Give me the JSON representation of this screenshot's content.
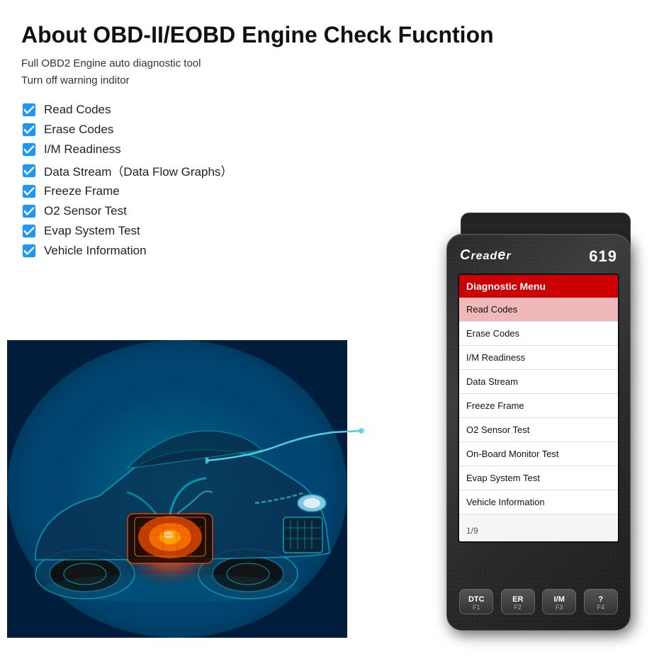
{
  "page": {
    "title": "About OBD-II/EOBD Engine Check Fucntion",
    "subtitles": [
      "Full OBD2 Engine auto diagnostic tool",
      "Turn off warning inditor"
    ]
  },
  "features": [
    {
      "id": "read-codes",
      "label": "Read Codes"
    },
    {
      "id": "erase-codes",
      "label": "Erase Codes"
    },
    {
      "id": "im-readiness",
      "label": "I/M Readiness"
    },
    {
      "id": "data-stream",
      "label": "Data Stream（Data Flow Graphs）"
    },
    {
      "id": "freeze-frame",
      "label": "Freeze Frame"
    },
    {
      "id": "o2-sensor",
      "label": "O2 Sensor Test"
    },
    {
      "id": "evap-system",
      "label": "Evap System Test"
    },
    {
      "id": "vehicle-info",
      "label": "Vehicle Information"
    }
  ],
  "device": {
    "model": "619",
    "logo": "Creader",
    "screen": {
      "header": "Diagnostic Menu",
      "menu_items": [
        {
          "label": "Read Codes",
          "highlighted": true
        },
        {
          "label": "Erase Codes",
          "highlighted": false
        },
        {
          "label": "I/M Readiness",
          "highlighted": false
        },
        {
          "label": "Data Stream",
          "highlighted": false
        },
        {
          "label": "Freeze Frame",
          "highlighted": false
        },
        {
          "label": "O2 Sensor Test",
          "highlighted": false
        },
        {
          "label": "On-Board Monitor Test",
          "highlighted": false
        },
        {
          "label": "Evap System Test",
          "highlighted": false
        },
        {
          "label": "Vehicle Information",
          "highlighted": false
        }
      ],
      "page_indicator": "1/9"
    },
    "buttons": [
      {
        "label": "DTC",
        "sublabel": "F1"
      },
      {
        "label": "ER",
        "sublabel": "F2"
      },
      {
        "label": "I/M",
        "sublabel": "F3"
      },
      {
        "label": "?",
        "sublabel": "F4"
      }
    ]
  }
}
